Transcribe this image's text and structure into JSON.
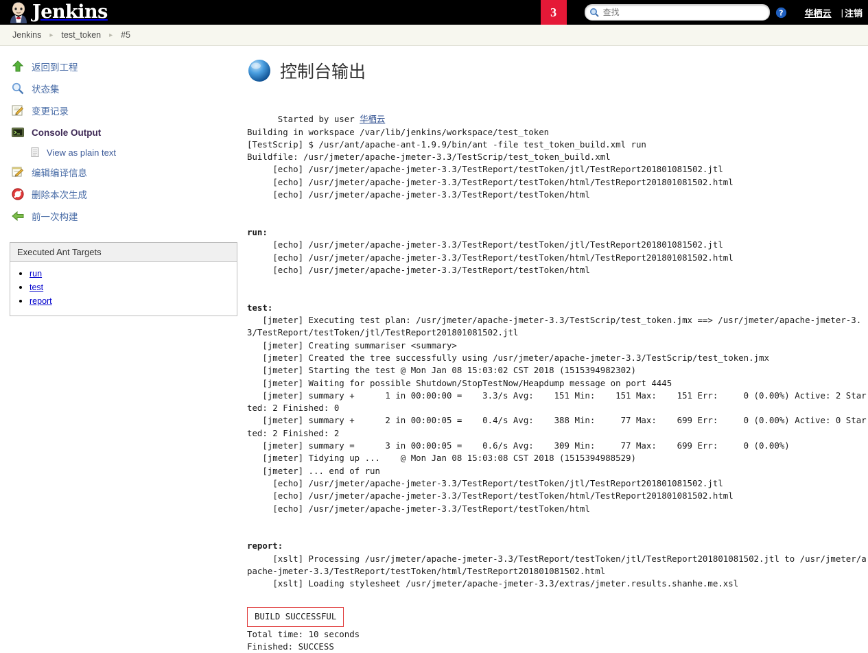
{
  "topbar": {
    "logo_text": "Jenkins",
    "badge_count": "3",
    "search_placeholder": "查找",
    "search_value": "",
    "user_name": "华栖云",
    "separator": "|",
    "logout_label": "注销"
  },
  "breadcrumb": {
    "items": [
      {
        "label": "Jenkins"
      },
      {
        "label": "test_token"
      },
      {
        "label": "#5"
      }
    ],
    "separator": "▸"
  },
  "sidebar": {
    "items": [
      {
        "label": "返回到工程",
        "icon": "up-arrow-icon",
        "name": "back-to-project"
      },
      {
        "label": "状态集",
        "icon": "magnifier-icon",
        "name": "status"
      },
      {
        "label": "变更记录",
        "icon": "changes-icon",
        "name": "changes"
      },
      {
        "label": "Console Output",
        "icon": "terminal-icon",
        "name": "console-output",
        "active": true
      },
      {
        "label": "编辑编译信息",
        "icon": "edit-icon",
        "name": "edit-build-information"
      },
      {
        "label": "删除本次生成",
        "icon": "delete-icon",
        "name": "delete-build"
      },
      {
        "label": "前一次构建",
        "icon": "left-arrow-icon",
        "name": "previous-build"
      }
    ],
    "subitem": {
      "label": "View as plain text",
      "icon": "document-icon"
    },
    "ant_panel": {
      "title": "Executed Ant Targets",
      "targets": [
        "run",
        "test",
        "report"
      ]
    }
  },
  "main": {
    "title": "控制台输出",
    "console": {
      "started_prefix": "Started by user ",
      "started_user": "华栖云",
      "lines_block1": [
        "Building in workspace /var/lib/jenkins/workspace/test_token",
        "[TestScrip] $ /usr/ant/apache-ant-1.9.9/bin/ant -file test_token_build.xml run",
        "Buildfile: /usr/jmeter/apache-jmeter-3.3/TestScrip/test_token_build.xml",
        "     [echo] /usr/jmeter/apache-jmeter-3.3/TestReport/testToken/jtl/TestReport201801081502.jtl",
        "     [echo] /usr/jmeter/apache-jmeter-3.3/TestReport/testToken/html/TestReport201801081502.html",
        "     [echo] /usr/jmeter/apache-jmeter-3.3/TestReport/testToken/html"
      ],
      "run_target": "run:",
      "lines_run": [
        "     [echo] /usr/jmeter/apache-jmeter-3.3/TestReport/testToken/jtl/TestReport201801081502.jtl",
        "     [echo] /usr/jmeter/apache-jmeter-3.3/TestReport/testToken/html/TestReport201801081502.html",
        "     [echo] /usr/jmeter/apache-jmeter-3.3/TestReport/testToken/html"
      ],
      "test_target": "test:",
      "lines_test": [
        "   [jmeter] Executing test plan: /usr/jmeter/apache-jmeter-3.3/TestScrip/test_token.jmx ==> /usr/jmeter/apache-jmeter-3.3/TestReport/testToken/jtl/TestReport201801081502.jtl",
        "   [jmeter] Creating summariser <summary>",
        "   [jmeter] Created the tree successfully using /usr/jmeter/apache-jmeter-3.3/TestScrip/test_token.jmx",
        "   [jmeter] Starting the test @ Mon Jan 08 15:03:02 CST 2018 (1515394982302)",
        "   [jmeter] Waiting for possible Shutdown/StopTestNow/Heapdump message on port 4445",
        "   [jmeter] summary +      1 in 00:00:00 =    3.3/s Avg:    151 Min:    151 Max:    151 Err:     0 (0.00%) Active: 2 Started: 2 Finished: 0",
        "   [jmeter] summary +      2 in 00:00:05 =    0.4/s Avg:    388 Min:     77 Max:    699 Err:     0 (0.00%) Active: 0 Started: 2 Finished: 2",
        "   [jmeter] summary =      3 in 00:00:05 =    0.6/s Avg:    309 Min:     77 Max:    699 Err:     0 (0.00%)",
        "   [jmeter] Tidying up ...    @ Mon Jan 08 15:03:08 CST 2018 (1515394988529)",
        "   [jmeter] ... end of run",
        "     [echo] /usr/jmeter/apache-jmeter-3.3/TestReport/testToken/jtl/TestReport201801081502.jtl",
        "     [echo] /usr/jmeter/apache-jmeter-3.3/TestReport/testToken/html/TestReport201801081502.html",
        "     [echo] /usr/jmeter/apache-jmeter-3.3/TestReport/testToken/html"
      ],
      "report_target": "report:",
      "lines_report": [
        "     [xslt] Processing /usr/jmeter/apache-jmeter-3.3/TestReport/testToken/jtl/TestReport201801081502.jtl to /usr/jmeter/apache-jmeter-3.3/TestReport/testToken/html/TestReport201801081502.html",
        "     [xslt] Loading stylesheet /usr/jmeter/apache-jmeter-3.3/extras/jmeter.results.shanhe.me.xsl"
      ],
      "build_result": "BUILD SUCCESSFUL",
      "lines_footer": [
        "Total time: 10 seconds",
        "Finished: SUCCESS"
      ]
    }
  },
  "colors": {
    "header_bg": "#000000",
    "badge_red": "#e51937",
    "breadcrumb_bg": "#f7f7ef",
    "link_blue": "#0000cc",
    "annotation_red": "#e03b3b"
  }
}
